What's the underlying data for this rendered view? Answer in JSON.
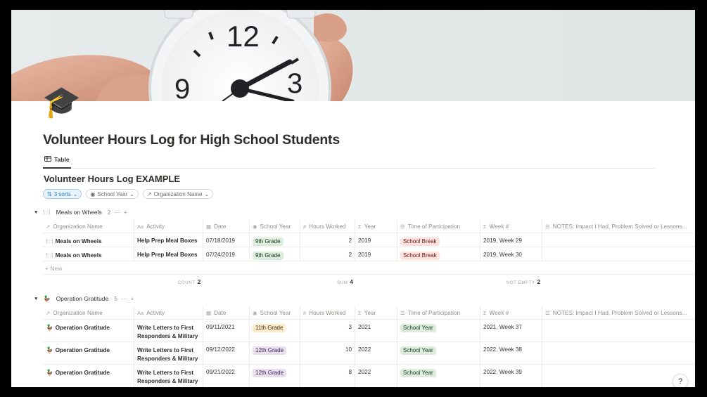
{
  "cover_alt": "alarm clock",
  "page_icon": "🎓",
  "page_title": "Volunteer Hours Log for High School Students",
  "view_tab": {
    "icon": "table-icon",
    "label": "Table"
  },
  "database_title": "Volunteer Hours Log EXAMPLE",
  "filters": {
    "sorts": "3 sorts",
    "school_year": "School Year",
    "organization_name": "Organization Name"
  },
  "columns": [
    {
      "icon": "↗",
      "label": "Organization Name"
    },
    {
      "icon": "Aa",
      "label": "Activity"
    },
    {
      "icon": "▦",
      "label": "Date"
    },
    {
      "icon": "◉",
      "label": "School Year"
    },
    {
      "icon": "#",
      "label": "Hours Worked"
    },
    {
      "icon": "Σ",
      "label": "Year"
    },
    {
      "icon": "☰",
      "label": "Time of Participation"
    },
    {
      "icon": "Σ",
      "label": "Week #"
    },
    {
      "icon": "☰",
      "label": "NOTES: Impact I Had, Problem Solved or Lessons..."
    }
  ],
  "groups": [
    {
      "emoji": "🍽️",
      "name": "Meals on Wheels",
      "count": "2",
      "rows": [
        {
          "org": "Meals on Wheels",
          "activity": "Help Prep Meal Boxes",
          "activity2": "",
          "date": "07/18/2019",
          "school_year": "9th Grade",
          "hours": "2",
          "year": "2019",
          "time": "School Break",
          "week": "2019, Week 29",
          "notes": ""
        },
        {
          "org": "Meals on Wheels",
          "activity": "Help Prep Meal Boxes",
          "activity2": "",
          "date": "07/24/2019",
          "school_year": "9th Grade",
          "hours": "2",
          "year": "2019",
          "time": "School Break",
          "week": "2019, Week 30",
          "notes": ""
        }
      ],
      "new_label": "+ New",
      "calc": {
        "count_label": "COUNT",
        "count": "2",
        "sum_label": "SUM",
        "sum": "4",
        "not_empty_label": "NOT EMPTY",
        "not_empty": "2"
      }
    },
    {
      "emoji": "🦆",
      "name": "Operation Gratitude",
      "count": "5",
      "rows": [
        {
          "org": "Operation Gratitude",
          "activity": "Write Letters to First",
          "activity2": "Responders & Military",
          "date": "09/11/2021",
          "school_year": "11th Grade",
          "hours": "3",
          "year": "2021",
          "time": "School Year",
          "week": "2021, Week 37",
          "notes": ""
        },
        {
          "org": "Operation Gratitude",
          "activity": "Write Letters to First",
          "activity2": "Responders & Military",
          "date": "09/12/2022",
          "school_year": "12th Grade",
          "hours": "10",
          "year": "2022",
          "time": "School Year",
          "week": "2022, Week 38",
          "notes": ""
        },
        {
          "org": "Operation Gratitude",
          "activity": "Write Letters to First",
          "activity2": "Responders & Military",
          "date": "09/21/2022",
          "school_year": "12th Grade",
          "hours": "8",
          "year": "2022",
          "time": "School Year",
          "week": "2022, Week 39",
          "notes": ""
        }
      ]
    }
  ],
  "help_label": "?"
}
